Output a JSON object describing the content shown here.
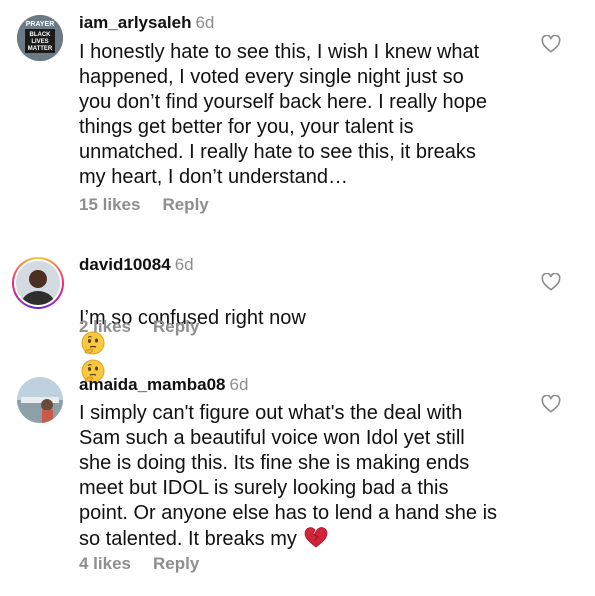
{
  "comments": [
    {
      "username": "iam_arlysaleh",
      "time": "6d",
      "avatar_text": [
        "PRAYER",
        "BLACK",
        "LIVES",
        "MATTER"
      ],
      "text": "I honestly hate to see this, I wish I knew what\nhappened, I voted every single night just so\nyou don’t find yourself back here. I really hope\nthings get better for you, your talent is\nunmatched. I really hate to see this, it breaks\nmy heart, I don’t understand…",
      "likes": "15 likes",
      "reply": "Reply"
    },
    {
      "username": "david10084",
      "time": "6d",
      "text": "I’m so confused right now",
      "emojis": [
        "thinking-face",
        "thinking-face"
      ],
      "likes": "2 likes",
      "reply": "Reply"
    },
    {
      "username": "amaida_mamba08",
      "time": "6d",
      "text": "I simply can't figure out what's the deal with\nSam such a beautiful voice won Idol yet still\nshe is doing this. Its fine she is making ends\nmeet but IDOL is surely looking bad a this\npoint. Or anyone else has to lend a hand she is\nso talented. It breaks my",
      "emojis": [
        "broken-heart"
      ],
      "likes": "4 likes",
      "reply": "Reply"
    }
  ],
  "icons": {
    "like": "heart-outline-icon"
  },
  "colors": {
    "meta": "#8e8e8e",
    "text": "#111111"
  }
}
